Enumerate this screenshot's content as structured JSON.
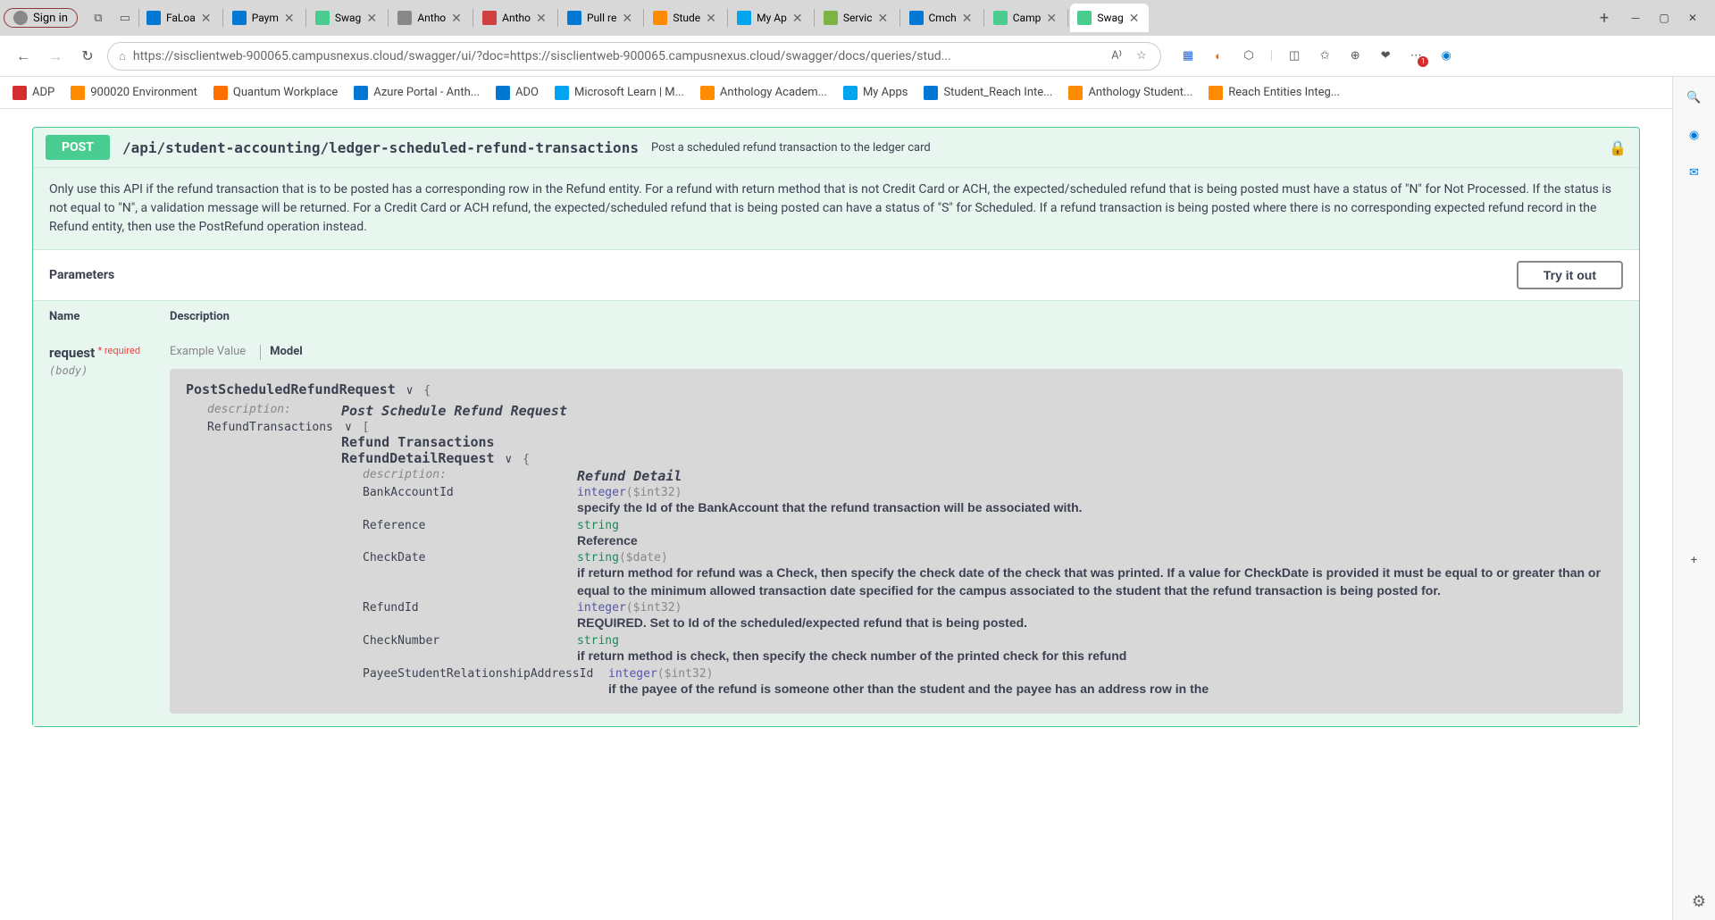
{
  "titlebar": {
    "signin": "Sign in",
    "tabs": [
      {
        "title": "FaLoa",
        "color": "#0078d4"
      },
      {
        "title": "Paym",
        "color": "#0078d4"
      },
      {
        "title": "Swag",
        "color": "#49cc90"
      },
      {
        "title": "Antho",
        "color": "#888"
      },
      {
        "title": "Antho",
        "color": "#d04040"
      },
      {
        "title": "Pull re",
        "color": "#0078d4"
      },
      {
        "title": "Stude",
        "color": "#ff8c00"
      },
      {
        "title": "My Ap",
        "color": "#00a4ef"
      },
      {
        "title": "Servic",
        "color": "#7cb342"
      },
      {
        "title": "Cmch",
        "color": "#0078d4"
      },
      {
        "title": "Camp",
        "color": "#49cc90"
      },
      {
        "title": "Swag",
        "color": "#49cc90",
        "active": true
      }
    ]
  },
  "addressbar": {
    "url": "https://sisclientweb-900065.campusnexus.cloud/swagger/ui/?doc=https://sisclientweb-900065.campusnexus.cloud/swagger/docs/queries/stud..."
  },
  "bookmarks": [
    {
      "label": "ADP",
      "color": "#d32f2f"
    },
    {
      "label": "900020 Environment",
      "color": "#ff8c00"
    },
    {
      "label": "Quantum Workplace",
      "color": "#ff6f00"
    },
    {
      "label": "Azure Portal - Anth...",
      "color": "#0078d4"
    },
    {
      "label": "ADO",
      "color": "#0078d4"
    },
    {
      "label": "Microsoft Learn | M...",
      "color": "#00a4ef"
    },
    {
      "label": "Anthology Academ...",
      "color": "#ff8c00"
    },
    {
      "label": "My Apps",
      "color": "#00a4ef"
    },
    {
      "label": "Student_Reach Inte...",
      "color": "#0078d4"
    },
    {
      "label": "Anthology Student...",
      "color": "#ff8c00"
    },
    {
      "label": "Reach Entities Integ...",
      "color": "#ff8c00"
    }
  ],
  "endpoint": {
    "method": "POST",
    "path": "/api/student-accounting/ledger-scheduled-refund-transactions",
    "summary": "Post a scheduled refund transaction to the ledger card",
    "description": "Only use this API if the refund transaction that is to be posted has a corresponding row in the Refund entity. For a refund with return method that is not Credit Card or ACH, the expected/scheduled refund that is being posted must have a status of \"N\" for Not Processed. If the status is not equal to \"N\", a validation message will be returned. For a Credit Card or ACH refund, the expected/scheduled refund that is being posted can have a status of \"S\" for Scheduled. If a refund transaction is being posted where there is no corresponding expected refund record in the Refund entity, then use the PostRefund operation instead."
  },
  "params": {
    "heading": "Parameters",
    "tryit": "Try it out",
    "col_name": "Name",
    "col_desc": "Description",
    "param_name": "request",
    "required": "required",
    "location": "(body)",
    "tab_example": "Example Value",
    "tab_model": "Model"
  },
  "model": {
    "root": "PostScheduledRefundRequest",
    "root_desc_key": "description:",
    "root_desc": "Post Schedule Refund Request",
    "refund_key": "RefundTransactions",
    "refund_title": "Refund Transactions",
    "detail_name": "RefundDetailRequest",
    "detail_desc_key": "description:",
    "detail_desc": "Refund Detail",
    "fields": {
      "BankAccountId": {
        "key": "BankAccountId",
        "type": "integer",
        "fmt": "($int32)",
        "desc": "specify the Id of the BankAccount that the refund transaction will be associated with."
      },
      "Reference": {
        "key": "Reference",
        "type": "string",
        "desc": "Reference"
      },
      "CheckDate": {
        "key": "CheckDate",
        "type": "string",
        "fmt": "($date)",
        "desc": "if return method for refund was a Check, then specify the check date of the check that was printed. If a value for CheckDate is provided it must be equal to or greater than or equal to the minimum allowed transaction date specified for the campus associated to the student that the refund transaction is being posted for."
      },
      "RefundId": {
        "key": "RefundId",
        "type": "integer",
        "fmt": "($int32)",
        "desc": "REQUIRED. Set to Id of the scheduled/expected refund that is being posted."
      },
      "CheckNumber": {
        "key": "CheckNumber",
        "type": "string",
        "desc": "if return method is check, then specify the check number of the printed check for this refund"
      },
      "PayeeAddr": {
        "key": "PayeeStudentRelationshipAddressId",
        "type": "integer",
        "fmt": "($int32)",
        "desc": "if the payee of the refund is someone other than the student and the payee has an address row in the"
      }
    }
  }
}
